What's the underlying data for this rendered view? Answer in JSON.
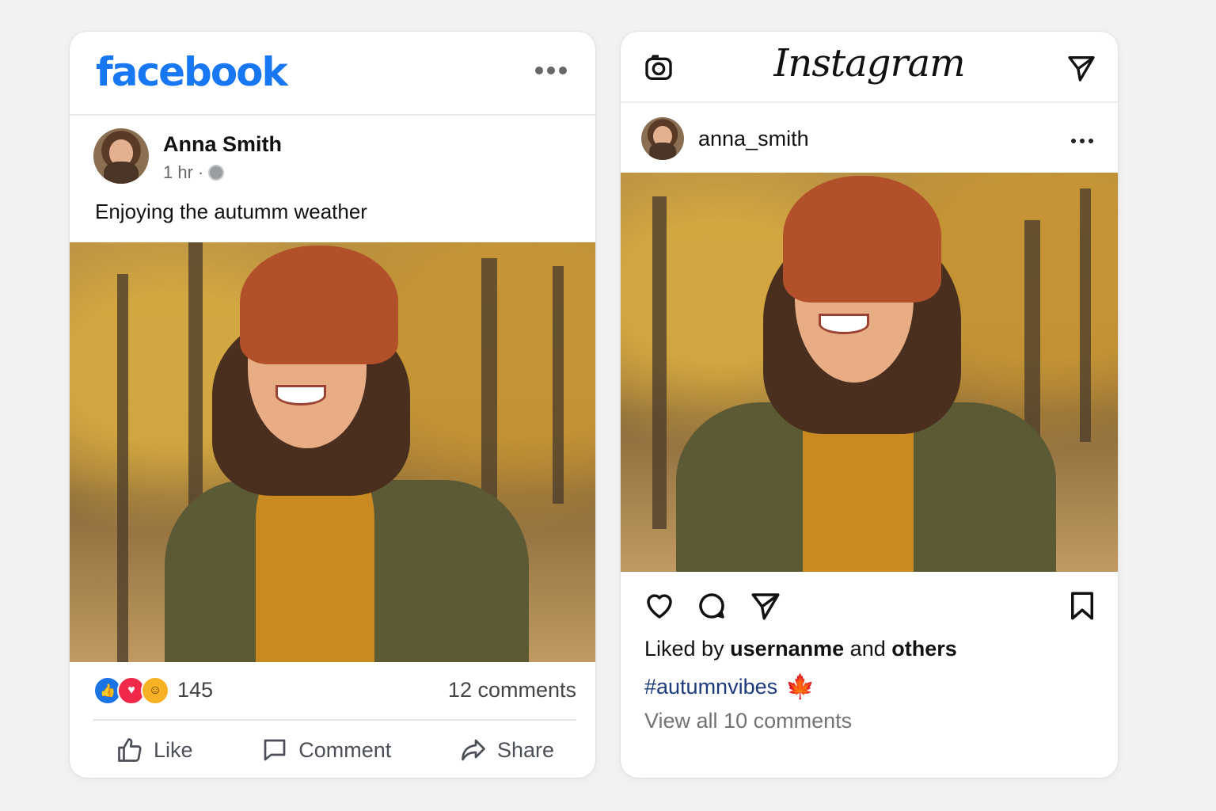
{
  "facebook": {
    "logo": "facebook",
    "user_name": "Anna Smith",
    "time": "1 hr",
    "separator": "·",
    "caption": "Enjoying the autumm weather",
    "reaction_count": "145",
    "comments_count": "12 comments",
    "reactions": [
      "like-icon",
      "love-icon",
      "haha-icon"
    ],
    "actions": {
      "like": "Like",
      "comment": "Comment",
      "share": "Share"
    },
    "brand_color": "#1877f2"
  },
  "instagram": {
    "logo": "Instagram",
    "username": "anna_smith",
    "likes": {
      "prefix": "Liked by",
      "user": "usernanme",
      "and": "and",
      "others": "others"
    },
    "hashtag": "#autumnvibes",
    "hashtag_icon": "maple-leaf-icon",
    "view_comments": "View all 10 comments",
    "hashtag_color": "#1d3b7a"
  }
}
